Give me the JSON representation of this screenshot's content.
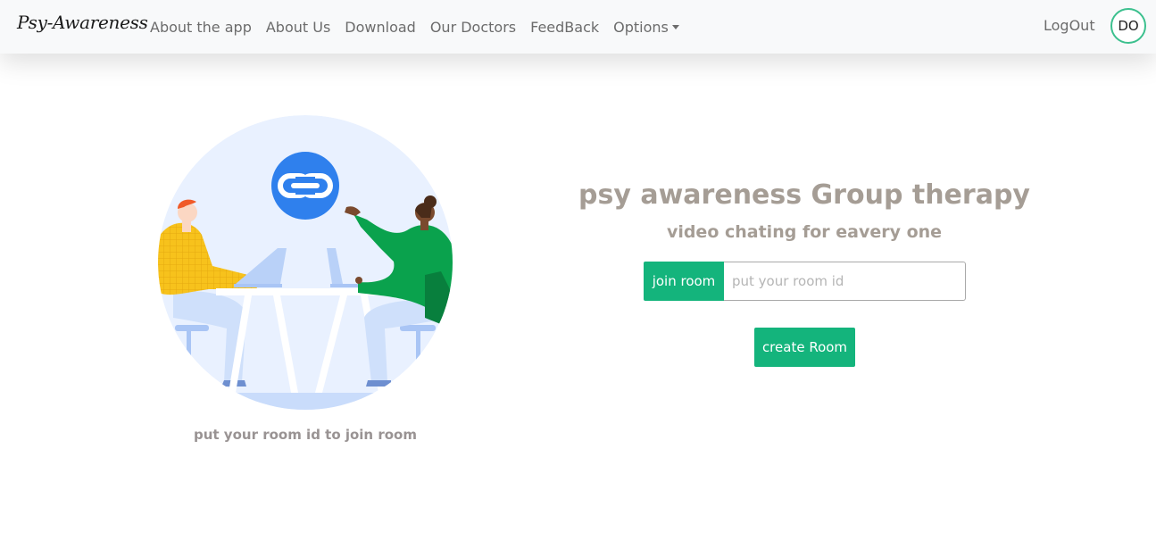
{
  "navbar": {
    "brand": "Psy-Awareness",
    "links": [
      "About the app",
      "About Us",
      "Download",
      "Our Doctors",
      "FeedBack"
    ],
    "options_label": "Options",
    "logout_label": "LogOut",
    "avatar_initials": "DO"
  },
  "illustration": {
    "icon": "link-icon",
    "caption": "put your room id to join room"
  },
  "main": {
    "title": "psy awareness Group therapy",
    "subtitle": "video chating for eavery one",
    "join_button": "join room",
    "room_input_placeholder": "put your room id",
    "room_input_value": "",
    "create_button": "create Room"
  },
  "colors": {
    "accent_green": "#14b47c",
    "title_gray": "#a59d95",
    "navbar_bg": "#f8f9fa",
    "link_blue": "#2f80ed"
  }
}
